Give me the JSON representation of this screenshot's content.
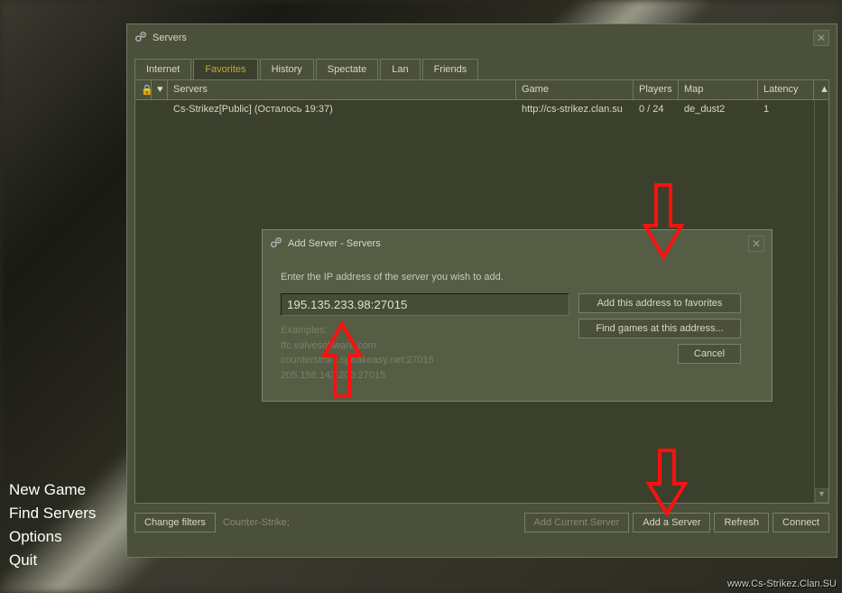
{
  "main_menu": {
    "new_game": "New Game",
    "find_servers": "Find Servers",
    "options": "Options",
    "quit": "Quit"
  },
  "servers_window": {
    "title": "Servers",
    "tabs": {
      "internet": "Internet",
      "favorites": "Favorites",
      "history": "History",
      "spectate": "Spectate",
      "lan": "Lan",
      "friends": "Friends"
    },
    "columns": {
      "servers": "Servers",
      "game": "Game",
      "players": "Players",
      "map": "Map",
      "latency": "Latency"
    },
    "rows": [
      {
        "name": "Cs-Strikez[Public] (Осталось 19:37)",
        "game": "http://cs-strikez.clan.su",
        "players": "0 / 24",
        "map": "de_dust2",
        "latency": "1"
      }
    ],
    "bottom": {
      "change_filters": "Change filters",
      "filter_text": "Counter-Strike;",
      "add_current": "Add Current Server",
      "add_server": "Add a Server",
      "refresh": "Refresh",
      "connect": "Connect"
    }
  },
  "dialog": {
    "title": "Add Server - Servers",
    "prompt": "Enter the IP address of the server you wish to add.",
    "input_value": "195.135.233.98:27015",
    "examples_label": "Examples:",
    "example1": "tfc.valvesoftware.com",
    "example2": "counterstrike.speakeasy.net:27016",
    "example3": "205.158.143.200:27015",
    "add_favorites": "Add this address to favorites",
    "find_games": "Find games at this address...",
    "cancel": "Cancel"
  },
  "watermark": "www.Cs-Strikez.Clan.SU"
}
